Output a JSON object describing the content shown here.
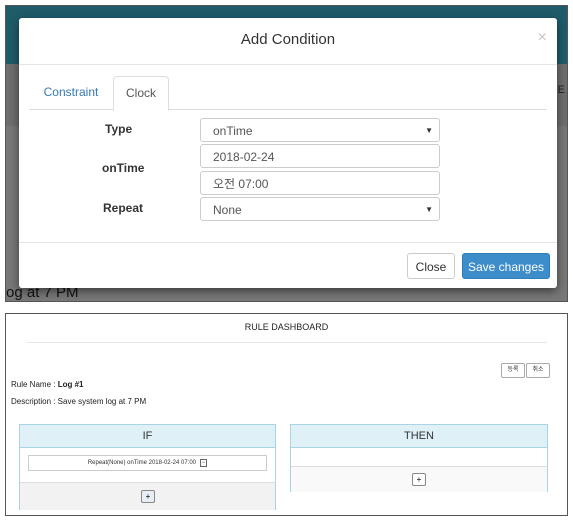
{
  "top_screenshot": {
    "background_fragment": "og at 7 PM",
    "right_fragment": "HE",
    "modal": {
      "title": "Add Condition",
      "close_icon": "×",
      "tabs": [
        {
          "label": "Constraint",
          "active": false
        },
        {
          "label": "Clock",
          "active": true
        }
      ],
      "form": {
        "type_label": "Type",
        "type_value": "onTime",
        "ontime_label": "onTime",
        "date_value": "2018-02-24",
        "time_value": "오전 07:00",
        "repeat_label": "Repeat",
        "repeat_value": "None"
      },
      "footer": {
        "close_label": "Close",
        "save_label": "Save changes"
      }
    }
  },
  "bottom_screenshot": {
    "title": "RULE DASHBOARD",
    "buttons": [
      "등록",
      "취소"
    ],
    "rule_name_label": "Rule Name : ",
    "rule_name_value": "Log #1",
    "description": "Description : Save system log at 7 PM",
    "if_panel": {
      "title": "IF",
      "condition": "Repeat(None) onTime 2018-02-24 07:00",
      "remove_symbol": "−",
      "add_symbol": "+"
    },
    "then_panel": {
      "title": "THEN",
      "add_symbol": "+"
    }
  },
  "colors": {
    "primary_button": "#3c8dc9",
    "link_tab": "#337ab7",
    "panel_header": "#dff0f7",
    "panel_border": "#a9d4e3",
    "top_bar": "#1e5c6a"
  }
}
